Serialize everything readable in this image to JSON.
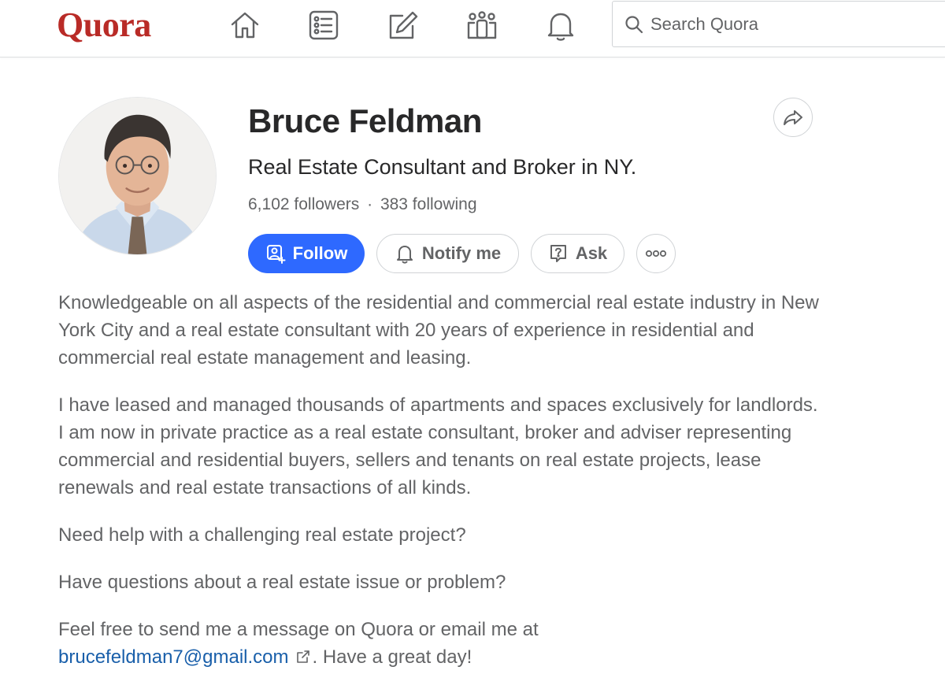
{
  "header": {
    "logo": "Quora",
    "nav": [
      "home-icon",
      "following-feed-icon",
      "answer-icon",
      "spaces-icon",
      "notifications-icon"
    ],
    "search_placeholder": "Search Quora"
  },
  "profile": {
    "name": "Bruce Feldman",
    "headline": "Real Estate Consultant and Broker in NY.",
    "followers": "6,102 followers",
    "separator": "·",
    "following": "383 following"
  },
  "actions": {
    "follow": "Follow",
    "notify": "Notify me",
    "ask": "Ask"
  },
  "bio": {
    "p1": "Knowledgeable on all aspects of the residential and commercial real estate industry in New York City and a real estate consultant with 20 years of experience in residential and commercial real estate management and leasing.",
    "p2": "I have leased and managed thousands of apartments and spaces exclusively for landlords. I am now in private practice as a real estate consultant, broker and adviser representing commercial and residential buyers, sellers and tenants on real estate projects, lease renewals and real estate transactions of all kinds.",
    "p3": "Need help with a challenging real estate project?",
    "p4": "Have questions about a real estate issue or problem?",
    "p5_text": "Feel free to send me a message on Quora or email me at",
    "email": "brucefeldman7@gmail.com",
    "p5_tail": ". Have a great day!"
  },
  "colors": {
    "brand": "#b92b27",
    "primary": "#2e69ff",
    "link": "#195faa",
    "text": "#282829",
    "muted": "#636466"
  }
}
